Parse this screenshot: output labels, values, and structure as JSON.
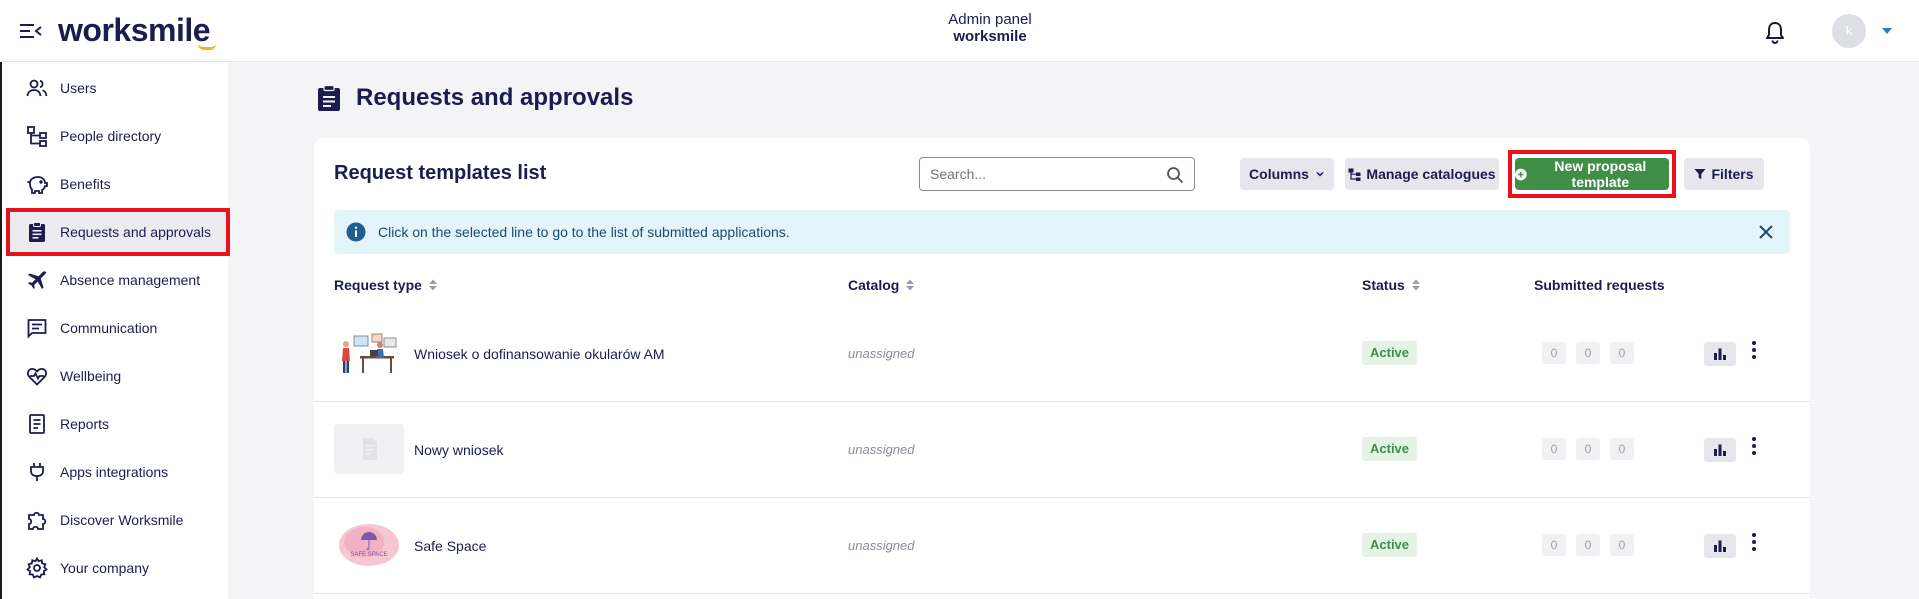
{
  "header": {
    "logo": "worksmile",
    "admin_title": "Admin panel",
    "admin_sub": "worksmile",
    "avatar_initial": "k"
  },
  "sidebar": {
    "items": [
      {
        "label": "Users",
        "icon": "users-icon"
      },
      {
        "label": "People directory",
        "icon": "org-chart-icon"
      },
      {
        "label": "Benefits",
        "icon": "piggy-bank-icon"
      },
      {
        "label": "Requests and approvals",
        "icon": "clipboard-icon",
        "active": true
      },
      {
        "label": "Absence management",
        "icon": "plane-icon"
      },
      {
        "label": "Communication",
        "icon": "message-icon"
      },
      {
        "label": "Wellbeing",
        "icon": "heart-pulse-icon"
      },
      {
        "label": "Reports",
        "icon": "report-icon"
      },
      {
        "label": "Apps integrations",
        "icon": "plug-icon"
      },
      {
        "label": "Discover Worksmile",
        "icon": "puzzle-icon"
      },
      {
        "label": "Your company",
        "icon": "gear-icon"
      }
    ]
  },
  "page": {
    "title": "Requests and approvals"
  },
  "card": {
    "title": "Request templates list",
    "search_placeholder": "Search...",
    "columns_label": "Columns",
    "manage_label": "Manage catalogues",
    "new_label": "New proposal template",
    "filters_label": "Filters",
    "info_text": "Click on the selected line to go to the list of submitted applications."
  },
  "table": {
    "headers": {
      "type": "Request type",
      "catalog": "Catalog",
      "status": "Status",
      "submitted": "Submitted requests"
    },
    "rows": [
      {
        "name": "Wniosek o dofinansowanie okularów AM",
        "catalog": "unassigned",
        "status": "Active",
        "counts": [
          "0",
          "0",
          "0"
        ]
      },
      {
        "name": "Nowy wniosek",
        "catalog": "unassigned",
        "status": "Active",
        "counts": [
          "0",
          "0",
          "0"
        ]
      },
      {
        "name": "Safe Space",
        "catalog": "unassigned",
        "status": "Active",
        "counts": [
          "0",
          "0",
          "0"
        ],
        "thumb_text": "SAFE SPACE"
      }
    ]
  },
  "colors": {
    "brand": "#1c1c52",
    "primary_green": "#3f8f47",
    "highlight_red": "#e8131a",
    "accent_yellow": "#f5b21b"
  }
}
